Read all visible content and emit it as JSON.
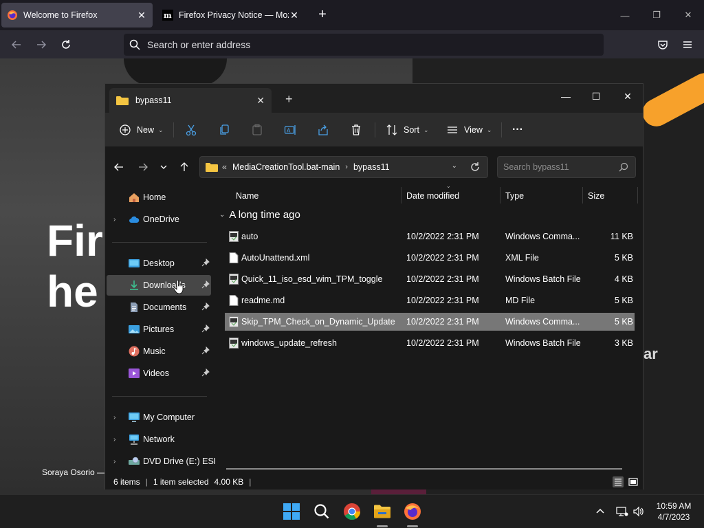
{
  "firefox": {
    "tabs": [
      {
        "label": "Welcome to Firefox",
        "active": true
      },
      {
        "label": "Firefox Privacy Notice — Mozill",
        "active": false
      }
    ],
    "urlbar": {
      "placeholder": "Search or enter address"
    }
  },
  "page": {
    "hero_line1": "Fir",
    "hero_line2": "he",
    "right_text": "ar",
    "caption": "Soraya Osorio —"
  },
  "explorer": {
    "tab_title": "bypass11",
    "toolbar": {
      "new_label": "New",
      "sort_label": "Sort",
      "view_label": "View",
      "more_label": "···"
    },
    "address": {
      "overflow": "«",
      "crumbs": [
        "MediaCreationTool.bat-main",
        "bypass11"
      ]
    },
    "search": {
      "placeholder": "Search bypass11"
    },
    "nav": {
      "home": "Home",
      "onedrive": "OneDrive",
      "desktop": "Desktop",
      "downloads": "Downloads",
      "documents": "Documents",
      "pictures": "Pictures",
      "music": "Music",
      "videos": "Videos",
      "mycomputer": "My Computer",
      "network": "Network",
      "dvd": "DVD Drive (E:) ESD-"
    },
    "columns": {
      "name": "Name",
      "date": "Date modified",
      "type": "Type",
      "size": "Size"
    },
    "group": "A long time ago",
    "files": [
      {
        "name": "auto",
        "date": "10/2/2022 2:31 PM",
        "type": "Windows Comma...",
        "size": "11 KB"
      },
      {
        "name": "AutoUnattend.xml",
        "date": "10/2/2022 2:31 PM",
        "type": "XML File",
        "size": "5 KB"
      },
      {
        "name": "Quick_11_iso_esd_wim_TPM_toggle",
        "date": "10/2/2022 2:31 PM",
        "type": "Windows Batch File",
        "size": "4 KB"
      },
      {
        "name": "readme.md",
        "date": "10/2/2022 2:31 PM",
        "type": "MD File",
        "size": "5 KB"
      },
      {
        "name": "Skip_TPM_Check_on_Dynamic_Update",
        "date": "10/2/2022 2:31 PM",
        "type": "Windows Comma...",
        "size": "5 KB"
      },
      {
        "name": "windows_update_refresh",
        "date": "10/2/2022 2:31 PM",
        "type": "Windows Batch File",
        "size": "3 KB"
      }
    ],
    "status": {
      "items": "6 items",
      "selected": "1 item selected",
      "size": "4.00 KB"
    }
  },
  "taskbar": {
    "time": "10:59 AM",
    "date": "4/7/2023"
  },
  "colors": {
    "firefox_bg": "#1c1b22",
    "explorer_bg": "#191919",
    "selection": "#777777",
    "accent_orange": "#f7a12b",
    "folder_yellow": "#f4c542"
  }
}
